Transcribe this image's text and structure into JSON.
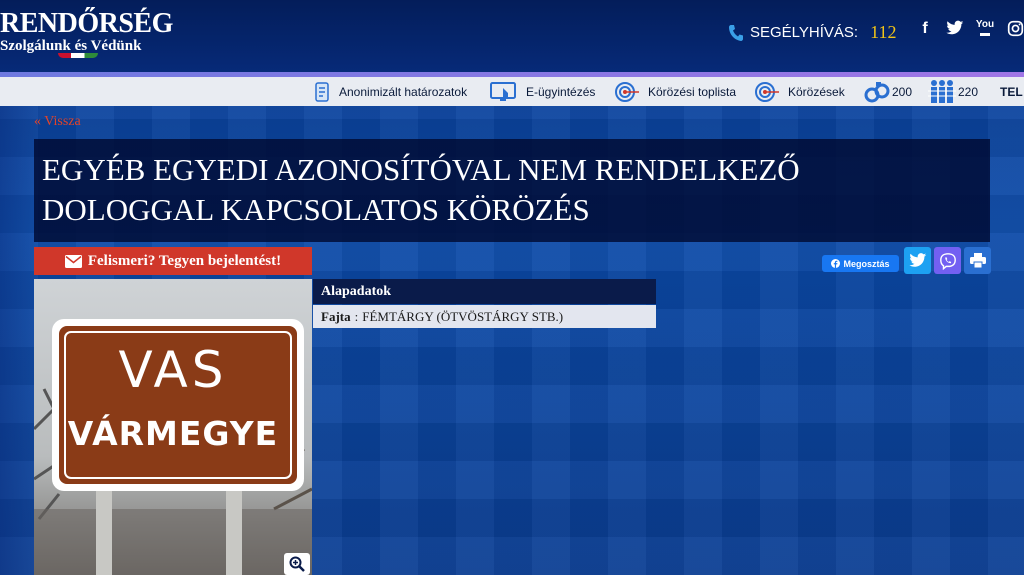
{
  "header": {
    "logo_title": "RENDŐRSÉG",
    "logo_subtitle": "Szolgálunk és Védünk",
    "hotline_label": "SEGÉLYHÍVÁS:",
    "hotline_number": "112",
    "social_icons": [
      "facebook-icon",
      "twitter-icon",
      "youtube-icon",
      "instagram-icon",
      "rss-icon"
    ]
  },
  "nav": {
    "items": [
      {
        "label": "Anonimizált határozatok",
        "icon": "document-icon"
      },
      {
        "label": "E-ügyintézés",
        "icon": "monitor-hand-icon"
      },
      {
        "label": "Körözési toplista",
        "icon": "target-icon"
      },
      {
        "label": "Körözések",
        "icon": "target-icon"
      },
      {
        "label": "200",
        "icon": "handcuffs-icon"
      },
      {
        "label": "220",
        "icon": "people-icon"
      },
      {
        "label": "TEL",
        "icon": ""
      }
    ]
  },
  "page": {
    "back_link": "« Vissza",
    "title": "EGYÉB EGYEDI AZONOSÍTÓVAL NEM RENDELKEZŐ DOLOGGAL KAPCSOLATOS KÖRÖZÉS",
    "report_button": "Felismeri? Tegyen bejelentést!",
    "share_label": "Megosztás"
  },
  "photo": {
    "line1": "VAS",
    "line2": "VÁRMEGYE"
  },
  "details": {
    "header": "Alapadatok",
    "rows": [
      {
        "key": "Fajta",
        "value": "FÉMTÁRGY (ÖTVÖSTÁRGY STB.)"
      }
    ]
  },
  "colors": {
    "accent_red": "#d0372a",
    "hotline_yellow": "#f2c417",
    "header_navy": "#041d5a",
    "facebook_blue": "#1877f2",
    "twitter_blue": "#1da1f2",
    "viber_purple": "#7360f2"
  }
}
